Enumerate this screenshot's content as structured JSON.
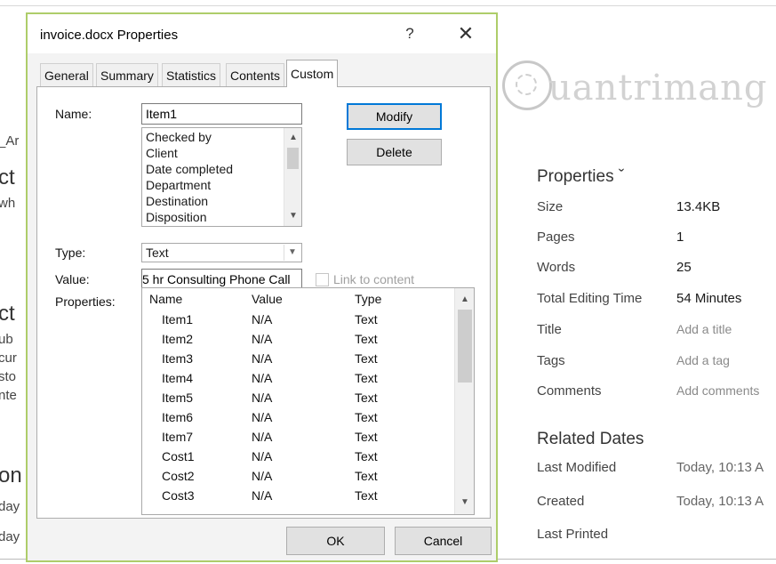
{
  "background": {
    "left_fragments": [
      "_Ar",
      "ct",
      "wh",
      "ct",
      "ub",
      "cur",
      "sto",
      "nte",
      "on",
      "day",
      "day"
    ],
    "watermark": "uantrimang",
    "properties_heading": "Properties ˇ",
    "properties": [
      {
        "label": "Size",
        "value": "13.4KB"
      },
      {
        "label": "Pages",
        "value": "1"
      },
      {
        "label": "Words",
        "value": "25"
      },
      {
        "label": "Total Editing Time",
        "value": "54 Minutes"
      },
      {
        "label": "Title",
        "value": "Add a title"
      },
      {
        "label": "Tags",
        "value": "Add a tag"
      },
      {
        "label": "Comments",
        "value": "Add comments"
      }
    ],
    "related_dates_heading": "Related Dates",
    "related_dates": [
      {
        "label": "Last Modified",
        "value": "Today, 10:13 A"
      },
      {
        "label": "Created",
        "value": "Today, 10:13 A"
      },
      {
        "label": "Last Printed",
        "value": ""
      }
    ]
  },
  "dialog": {
    "title": "invoice.docx Properties",
    "help": "?",
    "close": "✕",
    "tabs": [
      "General",
      "Summary",
      "Statistics",
      "Contents",
      "Custom"
    ],
    "active_tab": "Custom",
    "name_label": "Name:",
    "name_value": "Item1",
    "name_list": [
      "Checked by",
      "Client",
      "Date completed",
      "Department",
      "Destination",
      "Disposition"
    ],
    "modify_label": "Modify",
    "delete_label": "Delete",
    "type_label": "Type:",
    "type_value": "Text",
    "value_label": "Value:",
    "value_value": "5 hr Consulting Phone Call",
    "link_label": "Link to content",
    "properties_label": "Properties:",
    "columns": [
      "Name",
      "Value",
      "Type"
    ],
    "rows": [
      {
        "name": "Item1",
        "value": "N/A",
        "type": "Text"
      },
      {
        "name": "Item2",
        "value": "N/A",
        "type": "Text"
      },
      {
        "name": "Item3",
        "value": "N/A",
        "type": "Text"
      },
      {
        "name": "Item4",
        "value": "N/A",
        "type": "Text"
      },
      {
        "name": "Item5",
        "value": "N/A",
        "type": "Text"
      },
      {
        "name": "Item6",
        "value": "N/A",
        "type": "Text"
      },
      {
        "name": "Item7",
        "value": "N/A",
        "type": "Text"
      },
      {
        "name": "Cost1",
        "value": "N/A",
        "type": "Text"
      },
      {
        "name": "Cost2",
        "value": "N/A",
        "type": "Text"
      },
      {
        "name": "Cost3",
        "value": "N/A",
        "type": "Text"
      }
    ],
    "ok_label": "OK",
    "cancel_label": "Cancel"
  },
  "colors": {
    "dialog_border": "#aecd6a",
    "default_button_border": "#0078d7"
  }
}
